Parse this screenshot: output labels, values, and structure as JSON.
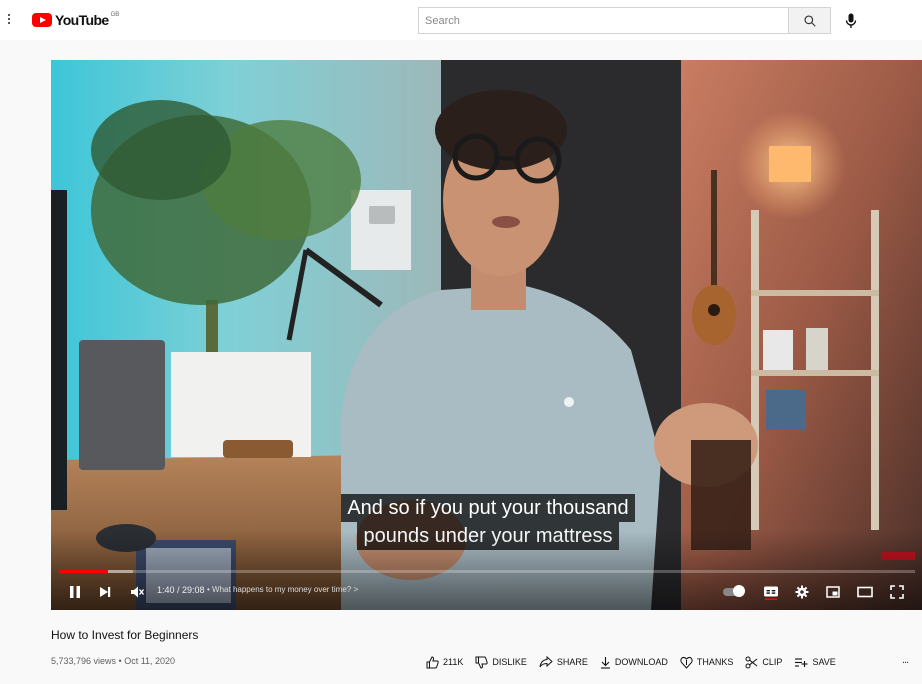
{
  "masthead": {
    "logo_text": "YouTube",
    "logo_region": "GB",
    "search_placeholder": "Search"
  },
  "player": {
    "captions": [
      "And so if you put your thousand",
      "pounds under your mattress"
    ],
    "time_display": "1:40 / 29:08",
    "chapter_separator": "•",
    "chapter_title": "What happens to my money over time?",
    "chapter_chevron": ">",
    "progress_fraction": 0.057,
    "muted": true,
    "autoplay_on": false,
    "colors": {
      "progress": "#ff0000"
    },
    "icons": [
      "pause-icon",
      "next-icon",
      "volume-muted-icon",
      "autoplay-toggle",
      "subtitles-icon",
      "settings-icon",
      "miniplayer-icon",
      "theater-icon",
      "fullscreen-icon"
    ]
  },
  "video": {
    "title": "How to Invest for Beginners",
    "meta": "5,733,796 views • Oct 11, 2020"
  },
  "actions": {
    "like_count": "211K",
    "dislike": "DISLIKE",
    "share": "SHARE",
    "download": "DOWNLOAD",
    "thanks": "THANKS",
    "clip": "CLIP",
    "save": "SAVE",
    "more": "..."
  }
}
